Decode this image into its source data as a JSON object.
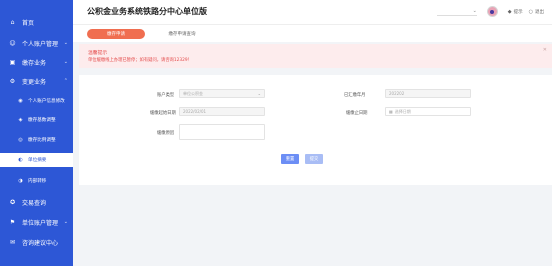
{
  "sidebar": {
    "items": [
      {
        "label": "首页",
        "icon": "home-icon"
      },
      {
        "label": "个人账户管理",
        "icon": "user-icon"
      },
      {
        "label": "缴存业务",
        "icon": "deposit-icon"
      },
      {
        "label": "变更业务",
        "icon": "change-icon"
      },
      {
        "label": "个人账户信息修改",
        "icon": "person-edit-icon"
      },
      {
        "label": "缴存基数调整",
        "icon": "base-adjust-icon"
      },
      {
        "label": "缴存比例调整",
        "icon": "ratio-adjust-icon"
      },
      {
        "label": "单位摘要",
        "icon": "unit-summary-icon"
      },
      {
        "label": "内部转移",
        "icon": "transfer-icon"
      },
      {
        "label": "交易查询",
        "icon": "query-icon"
      },
      {
        "label": "单位账户管理",
        "icon": "unit-account-icon"
      },
      {
        "label": "咨询建议中心",
        "icon": "consult-icon"
      }
    ]
  },
  "header": {
    "title": "公积金业务系统铁路分中心单位版",
    "user_select": "",
    "hint_label": "提示",
    "logout_label": "退出"
  },
  "tabs": [
    {
      "label": "缴存申请"
    },
    {
      "label": "缴存申请查询"
    }
  ],
  "warning": {
    "title": "温馨提示",
    "text": "单位缓缴线上办理已暂停；如有疑问，请咨询12329！"
  },
  "form": {
    "account_type_label": "账户类型",
    "account_type_value": "单位公积金",
    "last_paid_label": "已汇缴年月",
    "last_paid_value": "202202",
    "start_date_label": "缓缴起始日期",
    "start_date_value": "2022/02/01",
    "end_date_label": "缓缴止日期",
    "end_date_placeholder": "选择日期",
    "reason_label": "缓缴原因",
    "reset_label": "重置",
    "submit_label": "提交"
  },
  "colors": {
    "sidebar_bg": "#2d57d6",
    "active_tab": "#f06e50",
    "warning_text": "#e44b4b",
    "primary_button": "#6c8ef5"
  }
}
